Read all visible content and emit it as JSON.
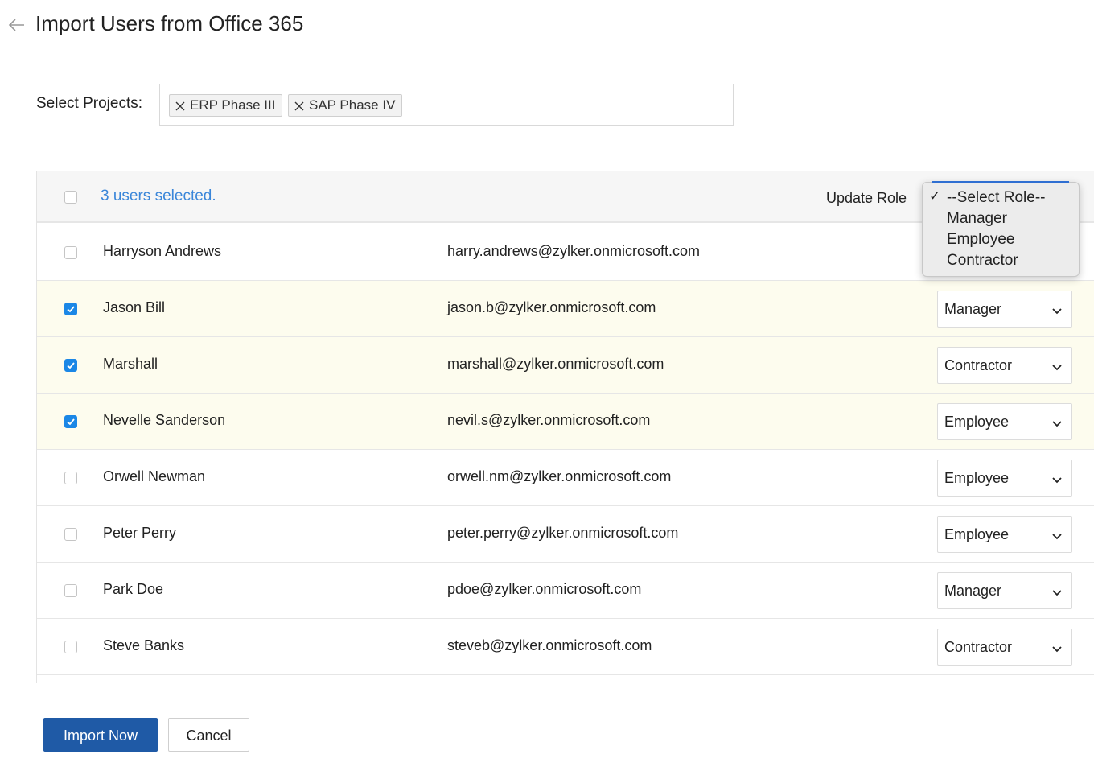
{
  "header": {
    "title": "Import Users from Office 365",
    "back_icon": "arrow-left-icon"
  },
  "projects": {
    "label": "Select Projects:",
    "chips": [
      {
        "label": "ERP Phase III",
        "remove_icon": "close-icon"
      },
      {
        "label": "SAP Phase IV",
        "remove_icon": "close-icon"
      }
    ]
  },
  "table": {
    "selected_text": "3 users selected.",
    "update_role_label": "Update Role",
    "role_menu": {
      "options": [
        "--Select Role--",
        "Manager",
        "Employee",
        "Contractor"
      ],
      "checked_option": "--Select Role--"
    },
    "rows": [
      {
        "name": "Harryson Andrews",
        "email": "harry.andrews@zylker.onmicrosoft.com",
        "role": "",
        "checked": false
      },
      {
        "name": "Jason Bill",
        "email": "jason.b@zylker.onmicrosoft.com",
        "role": "Manager",
        "checked": true
      },
      {
        "name": "Marshall",
        "email": "marshall@zylker.onmicrosoft.com",
        "role": "Contractor",
        "checked": true
      },
      {
        "name": "Nevelle Sanderson",
        "email": "nevil.s@zylker.onmicrosoft.com",
        "role": "Employee",
        "checked": true
      },
      {
        "name": "Orwell Newman",
        "email": "orwell.nm@zylker.onmicrosoft.com",
        "role": "Employee",
        "checked": false
      },
      {
        "name": "Peter Perry",
        "email": "peter.perry@zylker.onmicrosoft.com",
        "role": "Employee",
        "checked": false
      },
      {
        "name": "Park Doe",
        "email": "pdoe@zylker.onmicrosoft.com",
        "role": "Manager",
        "checked": false
      },
      {
        "name": "Steve Banks",
        "email": "steveb@zylker.onmicrosoft.com",
        "role": "Contractor",
        "checked": false
      }
    ]
  },
  "footer": {
    "import_label": "Import Now",
    "cancel_label": "Cancel"
  },
  "colors": {
    "primary": "#1f5aa6",
    "link": "#3a86d9",
    "checkbox": "#1b87e6",
    "selected_row": "#fdfcee"
  }
}
